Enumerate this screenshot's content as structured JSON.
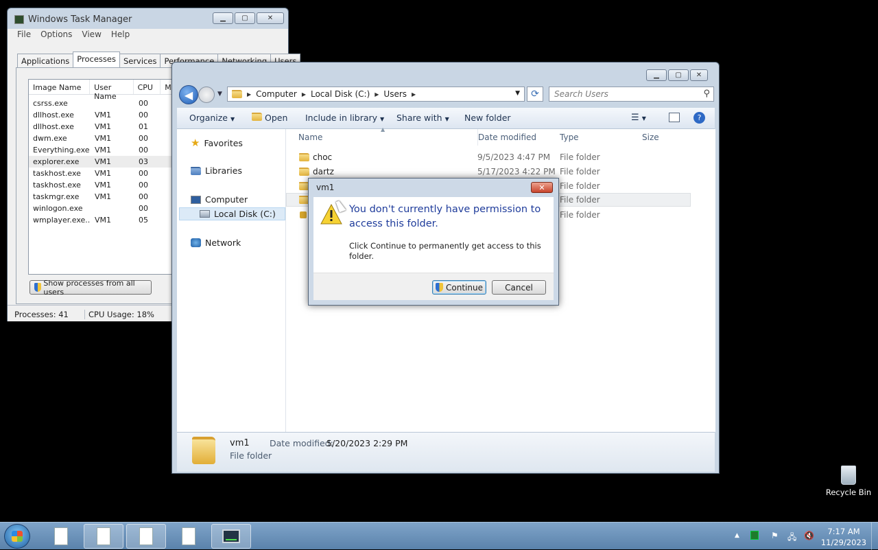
{
  "task_manager": {
    "title": "Windows Task Manager",
    "menu": [
      "File",
      "Options",
      "View",
      "Help"
    ],
    "tabs": [
      "Applications",
      "Processes",
      "Services",
      "Performance",
      "Networking",
      "Users"
    ],
    "active_tab": "Processes",
    "columns": [
      "Image Name",
      "User Name",
      "CPU",
      "Me"
    ],
    "rows": [
      {
        "name": "csrss.exe",
        "user": "",
        "cpu": "00"
      },
      {
        "name": "dllhost.exe",
        "user": "VM1",
        "cpu": "00"
      },
      {
        "name": "dllhost.exe",
        "user": "VM1",
        "cpu": "01"
      },
      {
        "name": "dwm.exe",
        "user": "VM1",
        "cpu": "00"
      },
      {
        "name": "Everything.exe",
        "user": "VM1",
        "cpu": "00"
      },
      {
        "name": "explorer.exe",
        "user": "VM1",
        "cpu": "03"
      },
      {
        "name": "taskhost.exe",
        "user": "VM1",
        "cpu": "00"
      },
      {
        "name": "taskhost.exe",
        "user": "VM1",
        "cpu": "00"
      },
      {
        "name": "taskmgr.exe",
        "user": "VM1",
        "cpu": "00"
      },
      {
        "name": "winlogon.exe",
        "user": "",
        "cpu": "00"
      },
      {
        "name": "wmplayer.exe...",
        "user": "VM1",
        "cpu": "05"
      }
    ],
    "show_all_label": "Show processes from all users",
    "status_processes": "Processes: 41",
    "status_cpu": "CPU Usage: 18%"
  },
  "explorer": {
    "breadcrumb": [
      "Computer",
      "Local Disk (C:)",
      "Users"
    ],
    "search_placeholder": "Search Users",
    "toolbar": {
      "organize": "Organize",
      "open": "Open",
      "include": "Include in library",
      "share": "Share with",
      "new_folder": "New folder"
    },
    "nav": {
      "favorites": "Favorites",
      "libraries": "Libraries",
      "computer": "Computer",
      "local_disk": "Local Disk (C:)",
      "network": "Network"
    },
    "columns": {
      "name": "Name",
      "date": "Date modified",
      "type": "Type",
      "size": "Size"
    },
    "files": [
      {
        "name": "choc",
        "date": "9/5/2023 4:47 PM",
        "type": "File folder"
      },
      {
        "name": "dartz",
        "date": "5/17/2023 4:22 PM",
        "type": "File folder"
      },
      {
        "name": "",
        "date": "",
        "type": "File folder"
      },
      {
        "name": "",
        "date": "",
        "type": "File folder"
      },
      {
        "name": "",
        "date": "",
        "type": "File folder"
      }
    ],
    "details": {
      "name": "vm1",
      "date_label": "Date modified:",
      "date_value": "5/20/2023 2:29 PM",
      "type": "File folder"
    }
  },
  "dialog": {
    "title": "vm1",
    "close_label": "✕",
    "main_text": "You don't currently have permission to access this folder.",
    "sub_text": "Click Continue to permanently get access to this folder.",
    "continue_label": "Continue",
    "cancel_label": "Cancel"
  },
  "desktop": {
    "recycle_bin": "Recycle Bin"
  },
  "taskbar": {
    "time": "7:17 AM",
    "date": "11/29/2023"
  }
}
